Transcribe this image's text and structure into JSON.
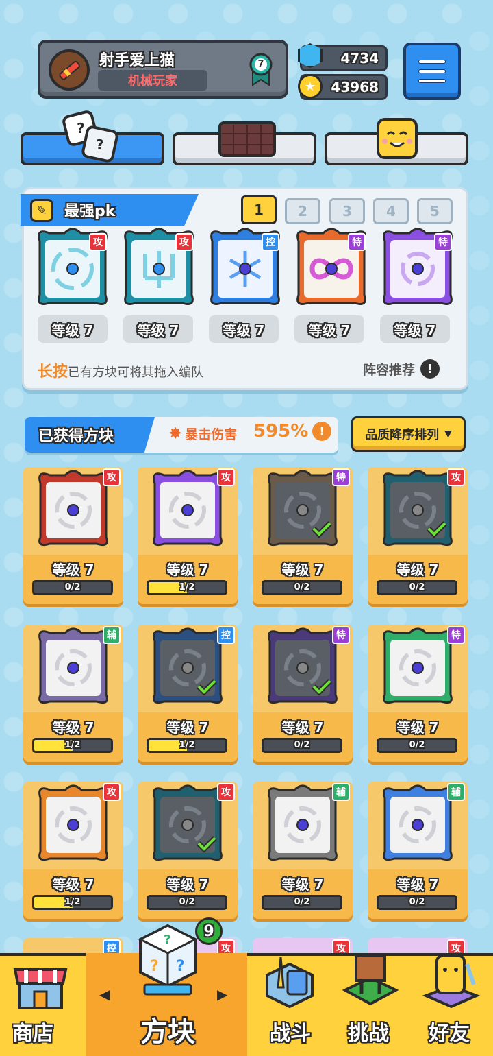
{
  "player": {
    "name": "射手爱上猫",
    "title": "机械玩家",
    "rank": "7"
  },
  "currency": {
    "gems": "4734",
    "coins": "43968"
  },
  "lineup": {
    "title": "最强pk",
    "pages": [
      "1",
      "2",
      "3",
      "4",
      "5"
    ],
    "active_page": "1",
    "slots": [
      {
        "tag": "攻",
        "level": "等级 7"
      },
      {
        "tag": "攻",
        "level": "等级 7"
      },
      {
        "tag": "控",
        "level": "等级 7"
      },
      {
        "tag": "特",
        "level": "等级 7"
      },
      {
        "tag": "特",
        "level": "等级 7"
      }
    ],
    "hint_prefix": "长按",
    "hint_rest": "已有方块可将其拖入编队",
    "recommend": "阵容推荐"
  },
  "obtained": {
    "title": "已获得方块",
    "crit_label": "暴击伤害",
    "crit_value": "595%",
    "sort_label": "品质降序排列"
  },
  "blocks": [
    {
      "tag": "攻",
      "level": "等级 7",
      "progress": "0/2",
      "fill": 0
    },
    {
      "tag": "攻",
      "level": "等级 7",
      "progress": "1/2",
      "fill": 0.5
    },
    {
      "tag": "特",
      "level": "等级 7",
      "progress": "0/2",
      "fill": 0
    },
    {
      "tag": "攻",
      "level": "等级 7",
      "progress": "0/2",
      "fill": 0
    },
    {
      "tag": "辅",
      "level": "等级 7",
      "progress": "1/2",
      "fill": 0.5
    },
    {
      "tag": "控",
      "level": "等级 7",
      "progress": "1/2",
      "fill": 0.5
    },
    {
      "tag": "特",
      "level": "等级 7",
      "progress": "0/2",
      "fill": 0
    },
    {
      "tag": "特",
      "level": "等级 7",
      "progress": "0/2",
      "fill": 0
    },
    {
      "tag": "攻",
      "level": "等级 7",
      "progress": "1/2",
      "fill": 0.5
    },
    {
      "tag": "攻",
      "level": "等级 7",
      "progress": "0/2",
      "fill": 0
    },
    {
      "tag": "辅",
      "level": "等级 7",
      "progress": "0/2",
      "fill": 0
    },
    {
      "tag": "辅",
      "level": "等级 7",
      "progress": "0/2",
      "fill": 0
    }
  ],
  "partial_row_tags": [
    "控",
    "攻",
    "攻",
    "攻"
  ],
  "nav": {
    "shop": "商店",
    "blocks": "方块",
    "battle": "战斗",
    "challenge": "挑战",
    "friends": "好友",
    "blocks_badge": "9"
  },
  "colors": {
    "tag_attack": "#e8333a",
    "tag_control": "#2f8ff0",
    "tag_special": "#9b3fd6",
    "tag_support": "#2fae6a"
  }
}
